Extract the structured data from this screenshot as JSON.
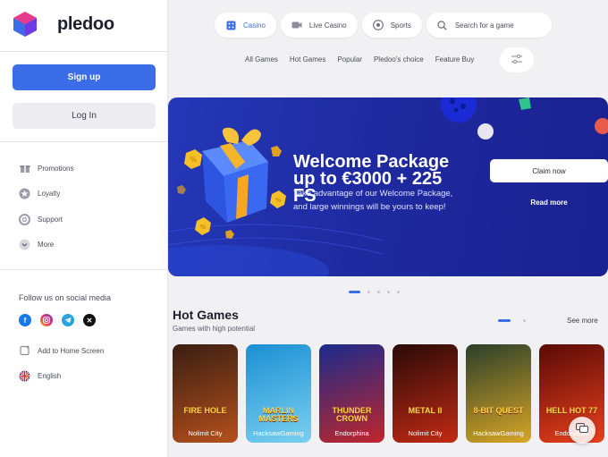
{
  "brand": {
    "name": "pledoo"
  },
  "sidebar": {
    "signup_label": "Sign up",
    "login_label": "Log In",
    "items": [
      {
        "label": "Promotions",
        "icon": "gift-icon"
      },
      {
        "label": "Loyalty",
        "icon": "star-icon"
      },
      {
        "label": "Support",
        "icon": "lifebuoy-icon"
      },
      {
        "label": "More",
        "icon": "chevron-down-icon"
      }
    ],
    "social_title": "Follow us on social media",
    "socials": [
      "facebook-icon",
      "instagram-icon",
      "telegram-icon",
      "x-icon"
    ],
    "home_screen_label": "Add to Home Screen",
    "language_label": "English"
  },
  "topbar": {
    "casino_label": "Casino",
    "live_casino_label": "Live Casino",
    "sports_label": "Sports",
    "search_placeholder": "Search for a game"
  },
  "categories": [
    "All Games",
    "Hot Games",
    "Popular",
    "Pledoo's choice",
    "Feature Buy"
  ],
  "banner": {
    "title_line1": "Welcome Package",
    "title_line2": "up to €3000 + 225 FS",
    "subtitle_line1": "Take advantage of our Welcome Package,",
    "subtitle_line2": "and large winnings will be yours to keep!",
    "claim_label": "Claim now",
    "read_more_label": "Read more",
    "slide_count": 5,
    "active_slide": 1
  },
  "hot_games": {
    "title": "Hot Games",
    "subtitle": "Games with high potential",
    "see_more_label": "See more",
    "games": [
      {
        "art_text": "FIRE HOLE",
        "provider": "Nolimit City",
        "colors": [
          "#3a1e12",
          "#b5501c"
        ]
      },
      {
        "art_text": "MARLIN MASTERS",
        "provider": "HacksawGaming",
        "colors": [
          "#1b8fd4",
          "#7ad0f0"
        ]
      },
      {
        "art_text": "THUNDER CROWN",
        "provider": "Endorphina",
        "colors": [
          "#1a2a8c",
          "#c0262b"
        ]
      },
      {
        "art_text": "METAL II",
        "provider": "Nolimit City",
        "colors": [
          "#2a0a08",
          "#c22a14"
        ]
      },
      {
        "art_text": "8-BIT QUEST",
        "provider": "HacksawGaming",
        "colors": [
          "#2a3f2a",
          "#d9a526"
        ]
      },
      {
        "art_text": "HELL HOT 77",
        "provider": "Endorphina",
        "colors": [
          "#5a0a06",
          "#e8401c"
        ]
      }
    ]
  },
  "colors": {
    "accent": "#3b6ee6",
    "banner": "#2236b0"
  }
}
